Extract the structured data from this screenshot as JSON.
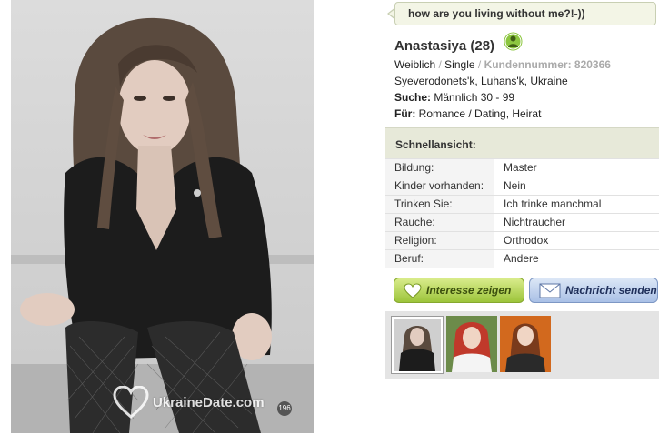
{
  "main_photo": {
    "watermark": "UkraineDate.com",
    "photo_count": "196"
  },
  "bubble": {
    "text": "how are you living without me?!-))"
  },
  "profile": {
    "name": "Anastasiya (28)",
    "gender": "Weiblich",
    "status": "Single",
    "customer_number": "Kundennummer: 820366",
    "location": "Syeverodonets'k, Luhans'k, Ukraine",
    "search_label": "Suche:",
    "search_value": "Männlich 30 - 99",
    "for_label": "Für:",
    "for_value": "Romance / Dating, Heirat"
  },
  "quick_view": {
    "title": "Schnellansicht:",
    "rows": [
      {
        "label": "Bildung:",
        "value": "Master"
      },
      {
        "label": "Kinder vorhanden:",
        "value": "Nein"
      },
      {
        "label": "Trinken Sie:",
        "value": "Ich trinke manchmal"
      },
      {
        "label": "Rauche:",
        "value": "Nichtraucher"
      },
      {
        "label": "Religion:",
        "value": "Orthodox"
      },
      {
        "label": "Beruf:",
        "value": "Andere"
      }
    ]
  },
  "buttons": {
    "interest": "Interesse zeigen",
    "message": "Nachricht senden"
  },
  "icons": {
    "online": "online-user-icon",
    "heart": "heart-icon",
    "envelope": "envelope-icon"
  },
  "colors": {
    "accent_green": "#8cc63f",
    "button_blue": "#a9c0e6",
    "panel_header": "#e7e9d9"
  }
}
